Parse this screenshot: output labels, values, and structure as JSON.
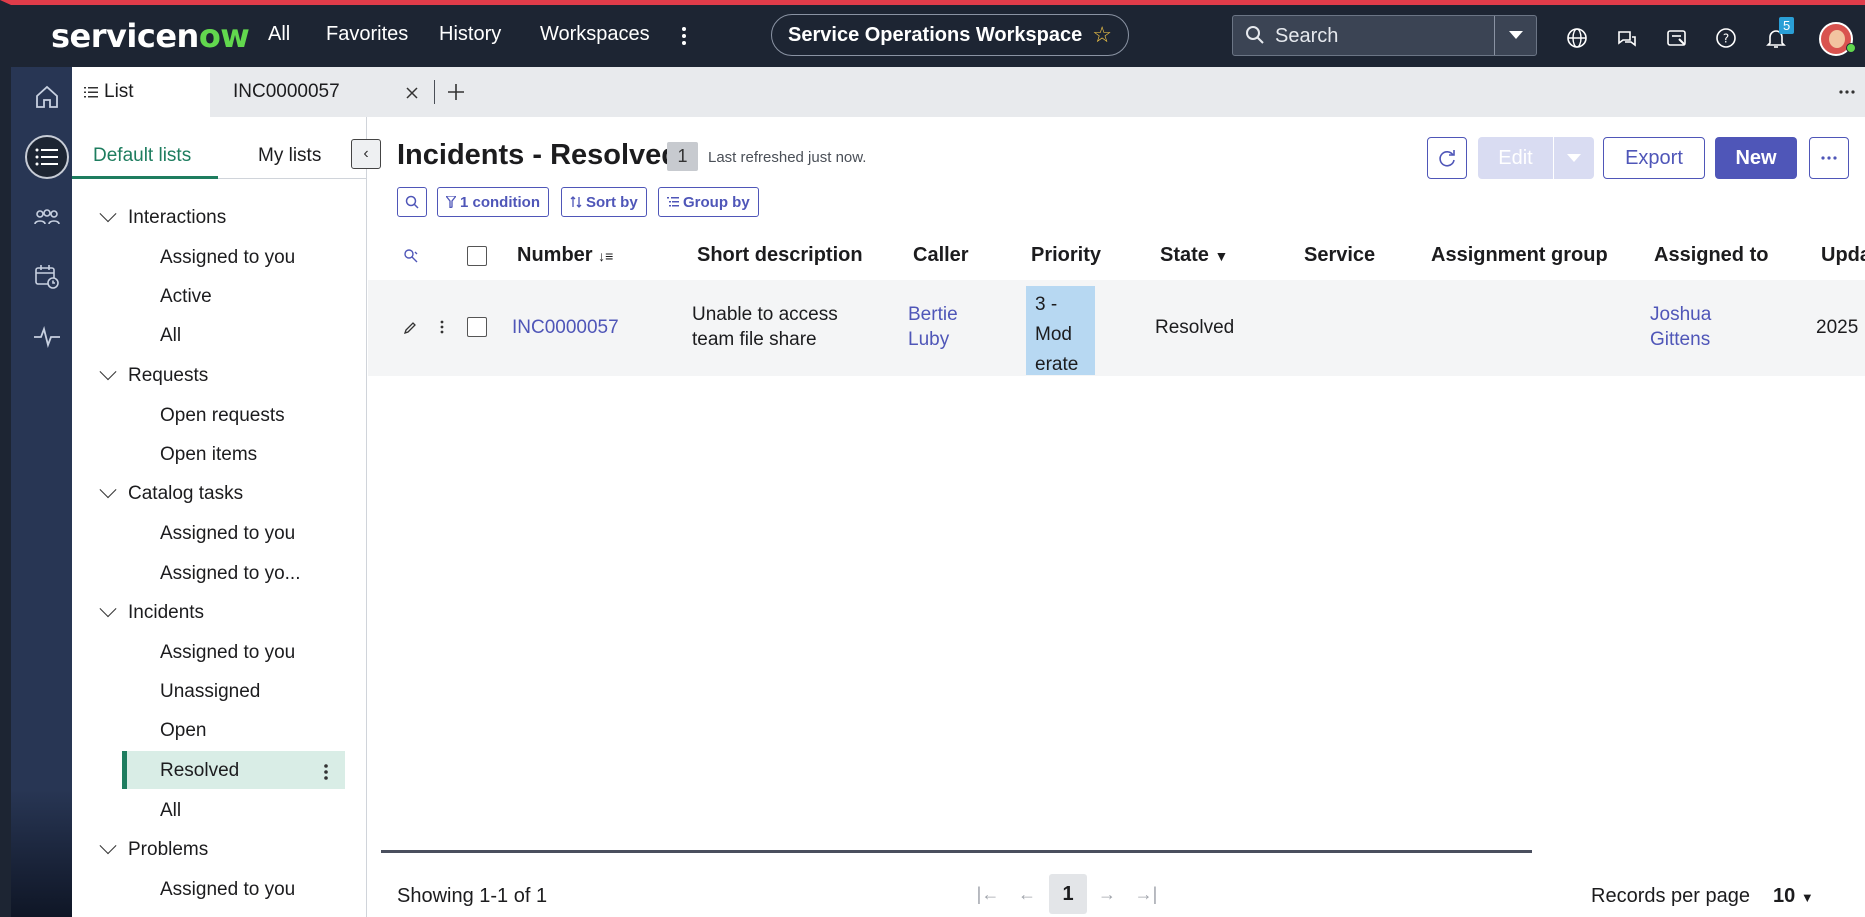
{
  "topnav": {
    "logo_pre": "servicen",
    "logo_ow": "ow",
    "menu": [
      "All",
      "Favorites",
      "History",
      "Workspaces"
    ],
    "workspace": "Service Operations Workspace",
    "search_placeholder": "Search",
    "notification_count": "5",
    "accent": "#62d84e",
    "brand_bar": "#e03c4a"
  },
  "tabs": {
    "list_label": "List",
    "record_label": "INC0000057"
  },
  "sidebar": {
    "tab_default": "Default lists",
    "tab_my": "My lists",
    "groups": [
      {
        "label": "Interactions",
        "items": [
          "Assigned to you",
          "Active",
          "All"
        ]
      },
      {
        "label": "Requests",
        "items": [
          "Open requests",
          "Open items"
        ]
      },
      {
        "label": "Catalog tasks",
        "items": [
          "Assigned to you",
          "Assigned to yo..."
        ]
      },
      {
        "label": "Incidents",
        "items": [
          "Assigned to you",
          "Unassigned",
          "Open",
          "Resolved",
          "All"
        ]
      },
      {
        "label": "Problems",
        "items": [
          "Assigned to you"
        ]
      }
    ],
    "selected": "Resolved"
  },
  "main": {
    "title": "Incidents - Resolved",
    "count": "1",
    "refreshed": "Last refreshed just now.",
    "btn_edit": "Edit",
    "btn_export": "Export",
    "btn_new": "New",
    "chip_condition": "1 condition",
    "chip_sort": "Sort by",
    "chip_group": "Group by"
  },
  "table": {
    "headers": [
      "Number",
      "Short description",
      "Caller",
      "Priority",
      "State",
      "Service",
      "Assignment group",
      "Assigned to",
      "Upda"
    ],
    "row": {
      "number": "INC0000057",
      "desc_l1": "Unable to access",
      "desc_l2": "team file share",
      "caller_l1": "Bertie",
      "caller_l2": "Luby",
      "prio_l1": "3 -",
      "prio_l2": "Mod",
      "prio_l3": "erate",
      "state": "Resolved",
      "assigned_l1": "Joshua",
      "assigned_l2": "Gittens",
      "updated": "2025"
    }
  },
  "footer": {
    "showing": "Showing 1-1 of 1",
    "page": "1",
    "records_label": "Records per page",
    "records_value": "10"
  }
}
